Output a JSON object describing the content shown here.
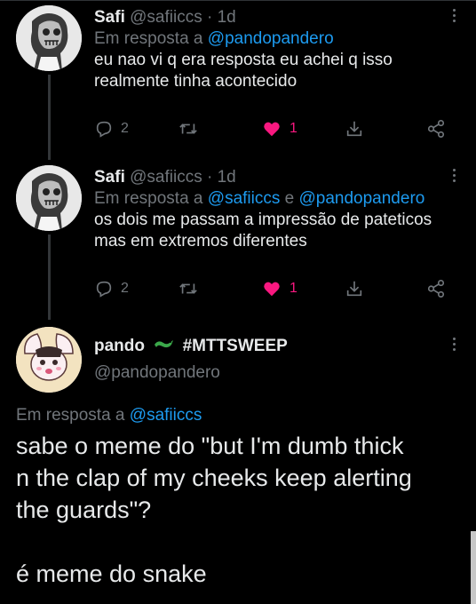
{
  "colors": {
    "background": "#000000",
    "text": "#e7e9ea",
    "secondary": "#71767b",
    "link": "#1d9bf0",
    "like": "#f91880"
  },
  "replies": [
    {
      "name": "Safi",
      "handle": "@safiiccs",
      "sep": "·",
      "time": "1d",
      "reply_prefix": "Em resposta a ",
      "reply_to_1": "@pandopandero",
      "reply_and": "",
      "reply_to_2": "",
      "text": "eu nao vi q era resposta eu achei q isso realmente tinha acontecido",
      "reply_count": "2",
      "like_count": "1",
      "icons": [
        "reply-icon",
        "retweet-icon",
        "heart-icon",
        "bookmark-icon",
        "share-icon"
      ]
    },
    {
      "name": "Safi",
      "handle": "@safiiccs",
      "sep": "·",
      "time": "1d",
      "reply_prefix": "Em resposta a ",
      "reply_to_1": "@safiiccs",
      "reply_and": " e ",
      "reply_to_2": "@pandopandero",
      "text": "os dois me passam a impressão de pateticos mas em extremos diferentes",
      "reply_count": "2",
      "like_count": "1",
      "icons": [
        "reply-icon",
        "retweet-icon",
        "heart-icon",
        "bookmark-icon",
        "share-icon"
      ]
    }
  ],
  "main": {
    "name": "pando",
    "badge_icon": "lizard-emoji-icon",
    "hashtag": "#MTTSWEEP",
    "handle": "@pandopandero",
    "reply_prefix": "Em resposta a ",
    "reply_to": "@safiiccs",
    "text_line_1": "sabe o meme do \"but I'm dumb thick",
    "text_line_2": "n the clap of my cheeks keep alerting",
    "text_line_3": "the guards\"?",
    "text_line_4": "é meme do snake"
  }
}
